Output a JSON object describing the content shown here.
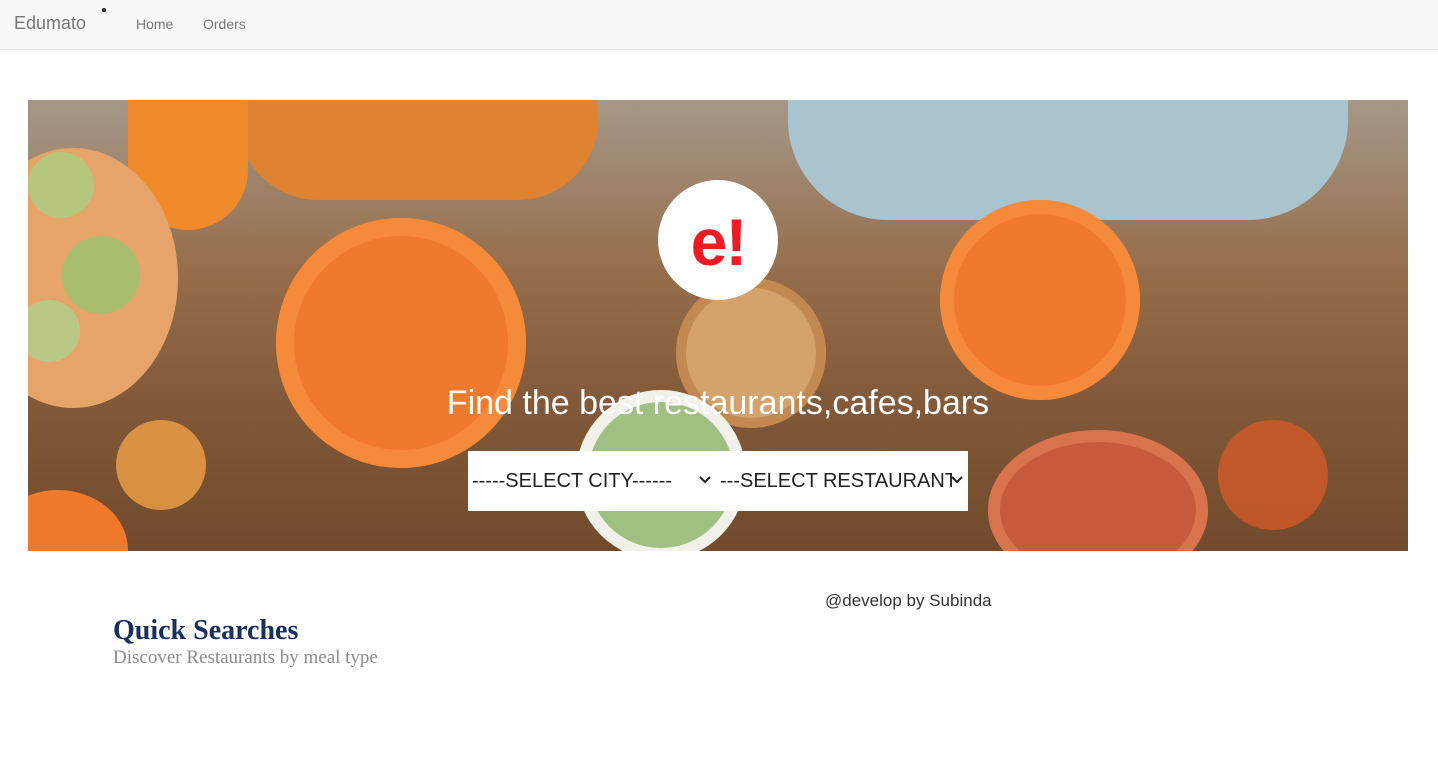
{
  "navbar": {
    "brand": "Edumato",
    "links": [
      {
        "label": "Home"
      },
      {
        "label": "Orders"
      }
    ]
  },
  "hero": {
    "logo_text": "e!",
    "title": "Find the best restaurants,cafes,bars",
    "city_select": {
      "selected": "-----SELECT CITY------"
    },
    "restaurant_select": {
      "selected": "---SELECT RESTAURANTS---"
    }
  },
  "quick_searches": {
    "title": "Quick Searches",
    "subtitle": "Discover Restaurants by meal type"
  },
  "credit": "@develop by Subinda",
  "colors": {
    "logo_red": "#ed1c24",
    "heading_navy": "#192f60",
    "navbar_bg": "#f8f8f8"
  },
  "icons": [
    "chevron-down-icon"
  ]
}
